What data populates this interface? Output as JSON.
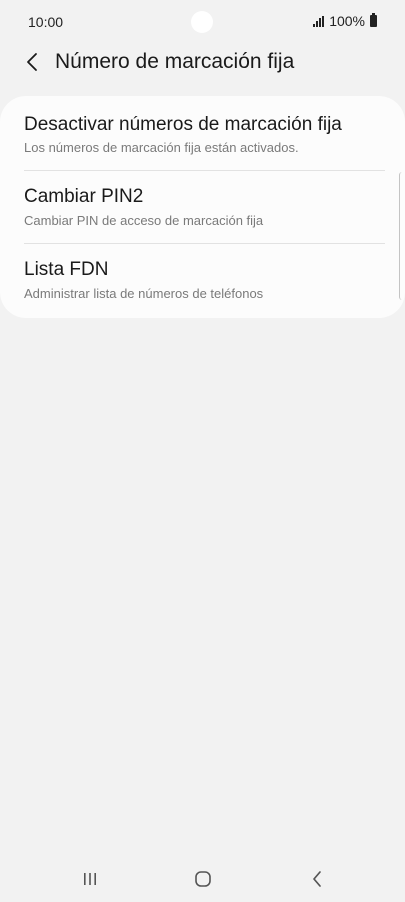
{
  "status_bar": {
    "time": "10:00",
    "battery": "100%",
    "icons": [
      "signal-icon",
      "battery-icon"
    ]
  },
  "header": {
    "back_icon": "chevron-left-icon",
    "title": "Número de marcación fija"
  },
  "settings": {
    "items": [
      {
        "title": "Desactivar números de marcación fija",
        "subtitle": "Los números de marcación fija están activados."
      },
      {
        "title": "Cambiar PIN2",
        "subtitle": "Cambiar PIN de acceso de marcación fija"
      },
      {
        "title": "Lista FDN",
        "subtitle": "Administrar lista de números de teléfonos"
      }
    ]
  },
  "nav_bar": {
    "icons": [
      "recent-apps-icon",
      "home-icon",
      "back-icon"
    ]
  },
  "colors": {
    "background": "#f2f2f2",
    "card": "#fcfcfc",
    "title_text": "#1a1a1a",
    "subtitle_text": "#7a7a7a"
  }
}
